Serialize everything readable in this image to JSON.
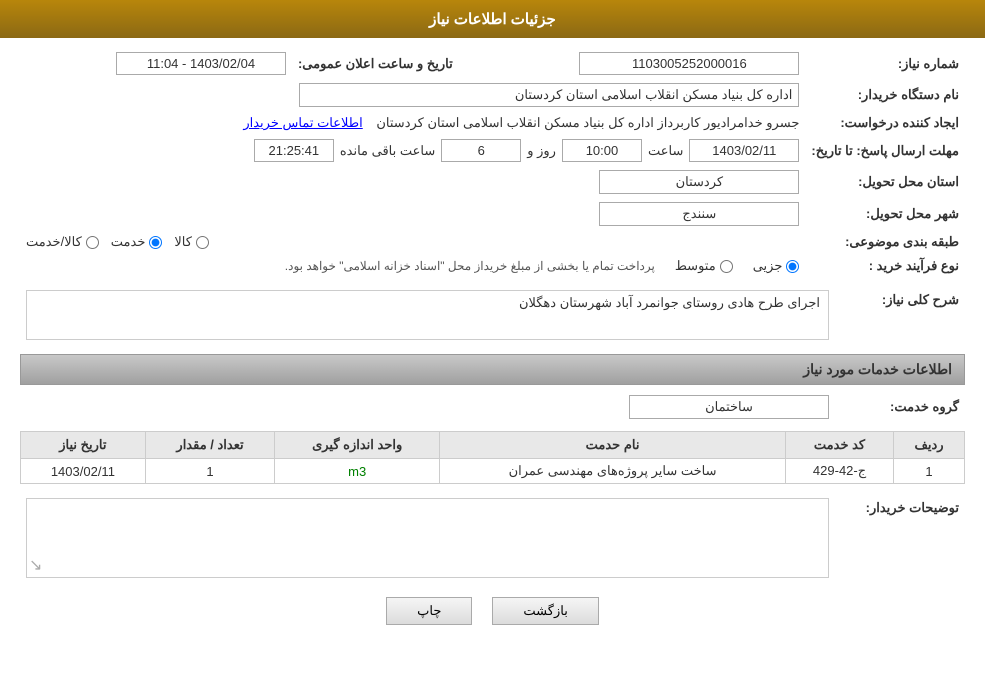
{
  "header": {
    "title": "جزئیات اطلاعات نیاز"
  },
  "fields": {
    "shomara_niaz_label": "شماره نیاز:",
    "shomara_niaz_value": "1103005252000016",
    "name_dastgah_label": "نام دستگاه خریدار:",
    "name_dastgah_value": "اداره کل بنیاد مسکن انقلاب اسلامی استان کردستان",
    "ijad_konande_label": "ایجاد کننده درخواست:",
    "ijad_konande_value": "جسرو خدامرادیور کاربرداز اداره کل بنیاد مسکن انقلاب اسلامی استان کردستان",
    "etelaat_tamas_label": "اطلاعات تماس خریدار",
    "mohlat_label": "مهلت ارسال پاسخ: تا تاریخ:",
    "date_value": "1403/02/11",
    "saat_label": "ساعت",
    "saat_value": "10:00",
    "roz_label": "روز و",
    "roz_value": "6",
    "baqi_label": "ساعت باقی مانده",
    "baqi_value": "21:25:41",
    "tarikh_label": "تاریخ و ساعت اعلان عمومی:",
    "tarikh_value": "1403/02/04 - 11:04",
    "ostan_label": "استان محل تحویل:",
    "ostan_value": "کردستان",
    "shahr_label": "شهر محل تحویل:",
    "shahr_value": "سنندج",
    "tabaqe_label": "طبقه بندی موضوعی:",
    "radio_kala": "کالا",
    "radio_khadamat": "خدمت",
    "radio_kala_khadamat": "کالا/خدمت",
    "radio_kala_checked": false,
    "radio_khadamat_checked": true,
    "radio_kala_khadamat_checked": false,
    "noFaraind_label": "نوع فرآیند خرید :",
    "radio_jozii": "جزیی",
    "radio_moutaset": "متوسط",
    "radio_description": "پرداخت تمام یا بخشی از مبلغ خریداز محل \"اسناد خزانه اسلامی\" خواهد بود.",
    "sharh_label": "شرح کلی نیاز:",
    "sharh_value": "اجرای طرح هادی روستای جوانمرد آباد شهرستان دهگلان",
    "khadamat_label": "اطلاعات خدمات مورد نیاز",
    "gorohe_khadamat_label": "گروه خدمت:",
    "gorohe_khadamat_value": "ساختمان",
    "table": {
      "headers": [
        "ردیف",
        "کد خدمت",
        "نام حدمت",
        "واحد اندازه گیری",
        "تعداد / مقدار",
        "تاریخ نیاز"
      ],
      "rows": [
        {
          "radif": "1",
          "code": "ج-42-429",
          "name": "ساخت سایر پروژه‌های مهندسی عمران",
          "unit": "m3",
          "count": "1",
          "date": "1403/02/11"
        }
      ]
    },
    "tousif_label": "توضیحات خریدار:",
    "tousif_value": "",
    "btn_chap": "چاپ",
    "btn_bazgasht": "بازگشت"
  }
}
